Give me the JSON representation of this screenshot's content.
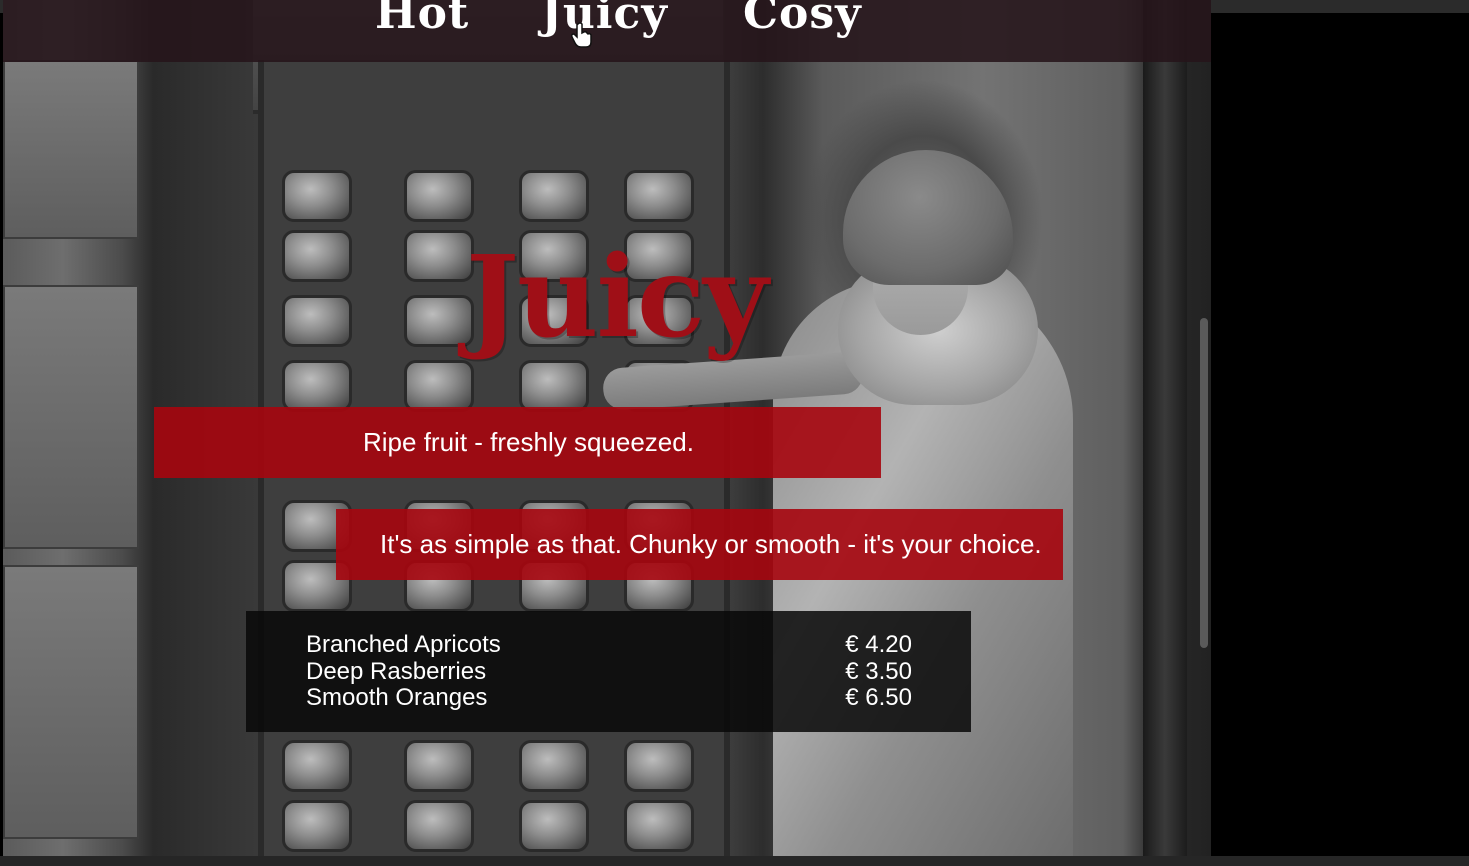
{
  "nav": {
    "links": [
      {
        "label": "Hot"
      },
      {
        "label": "Juicy"
      },
      {
        "label": "Cosy"
      }
    ]
  },
  "hero": {
    "title": "Juicy",
    "title_color": "#9f0f17"
  },
  "banners": [
    {
      "text": "Ripe fruit - freshly squeezed."
    },
    {
      "text": "It's as simple as that. Chunky or smooth - it's your choice."
    }
  ],
  "banner_color": "#a6060e",
  "menu": {
    "items": [
      {
        "name": "Branched Apricots",
        "price": "€ 4.20"
      },
      {
        "name": "Deep Rasberries",
        "price": "€ 3.50"
      },
      {
        "name": "Smooth Oranges",
        "price": "€ 6.50"
      }
    ]
  },
  "icons": {
    "cursor": "hand-pointer-icon"
  }
}
